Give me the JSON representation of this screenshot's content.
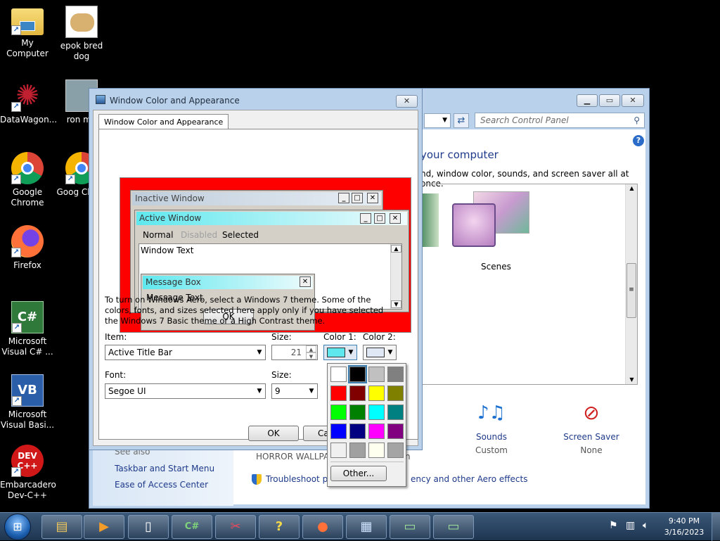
{
  "desktop": {
    "icons": [
      {
        "label": "My Computer"
      },
      {
        "label": "epok bred dog"
      },
      {
        "label": "DataWagon..."
      },
      {
        "label": "ron me"
      },
      {
        "label": "Google Chrome"
      },
      {
        "label": "Goog Chron"
      },
      {
        "label": "Firefox"
      },
      {
        "label": "Microsoft Visual C# ..."
      },
      {
        "label": "Microsoft Visual Basi..."
      },
      {
        "label": "Embarcadero Dev-C++"
      }
    ]
  },
  "control_panel": {
    "search_placeholder": "Search Control Panel",
    "heading": "your computer",
    "subheading": "nd, window color, sounds, and screen saver all at once.",
    "theme_label": "Scenes",
    "sounds_label": "Sounds",
    "sounds_value": "Custom",
    "screensaver_label": "Screen Saver",
    "screensaver_value": "None",
    "see_also": "See also",
    "link_taskbar": "Taskbar and Start Menu",
    "link_ease": "Ease of Access Center",
    "wallpaper_label": "HORROR WALLPAF",
    "troubleshoot_prefix": "Troubleshoot pro",
    "troubleshoot_suffix": "ency and other Aero effects",
    "wallpaper_suffix": "n"
  },
  "dialog": {
    "title": "Window Color and Appearance",
    "tab": "Window Color and Appearance",
    "preview": {
      "inactive_title": "Inactive Window",
      "active_title": "Active Window",
      "menu_normal": "Normal",
      "menu_disabled": "Disabled",
      "menu_selected": "Selected",
      "window_text": "Window Text",
      "msgbox_title": "Message Box",
      "msgbox_text": "Message Text",
      "msgbox_ok": "OK"
    },
    "info": "To turn on Windows Aero, select a Windows 7 theme.  Some of the colors, fonts, and sizes selected here apply only if you have selected the Windows 7 Basic theme or a High Contrast theme.",
    "item_label": "Item:",
    "item_value": "Active Title Bar",
    "size_label": "Size:",
    "size_value": "21",
    "color1_label": "Color 1:",
    "color2_label": "Color 2:",
    "color1_value": "#5ee8ee",
    "color2_value": "#dfe8f4",
    "font_label": "Font:",
    "font_value": "Segoe UI",
    "font_size_label": "Size:",
    "font_size_value": "9",
    "ok_label": "OK",
    "cancel_label": "Ca"
  },
  "palette": {
    "colors": [
      "#ffffff",
      "#000000",
      "#c0c0c0",
      "#808080",
      "#ff0000",
      "#800000",
      "#ffff00",
      "#808000",
      "#00ff00",
      "#008000",
      "#00ffff",
      "#008080",
      "#0000ff",
      "#000080",
      "#ff00ff",
      "#800080",
      "#f0f0f0",
      "#a0a0a0",
      "#fffff0",
      "#a4a4a4"
    ],
    "selected_index": 1,
    "other_label": "Other..."
  },
  "taskbar": {
    "time": "9:40 PM",
    "date": "3/16/2023"
  }
}
